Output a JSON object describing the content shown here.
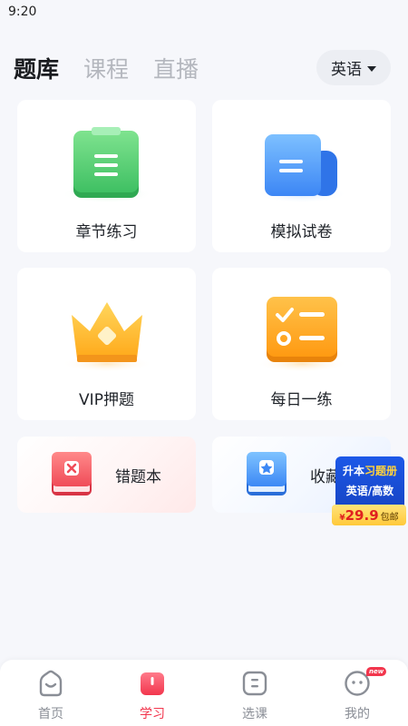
{
  "status_bar": {
    "time": "9:20"
  },
  "top_tabs": [
    {
      "label": "题库",
      "active": true
    },
    {
      "label": "课程",
      "active": false
    },
    {
      "label": "直播",
      "active": false
    }
  ],
  "subject_selector": {
    "label": "英语"
  },
  "cards": {
    "chapter_practice": {
      "label": "章节练习",
      "icon": "clipboard-icon"
    },
    "mock_exam": {
      "label": "模拟试卷",
      "icon": "document-icon"
    },
    "vip_predict": {
      "label": "VIP押题",
      "icon": "crown-icon"
    },
    "daily_practice": {
      "label": "每日一练",
      "icon": "calendar-checklist-icon"
    },
    "wrong_questions": {
      "label": "错题本",
      "icon": "wrong-book-icon"
    },
    "favorites": {
      "label": "收藏",
      "icon": "star-book-icon"
    }
  },
  "promo": {
    "line1_a": "升本",
    "line1_b": "习题册",
    "line2": "英语/高数",
    "currency": "¥",
    "price": "29.9",
    "shipping": "包邮"
  },
  "bottom_nav": [
    {
      "label": "首页",
      "icon": "home-icon",
      "active": false
    },
    {
      "label": "学习",
      "icon": "study-book-icon",
      "active": true
    },
    {
      "label": "选课",
      "icon": "course-icon",
      "active": false
    },
    {
      "label": "我的",
      "icon": "profile-icon",
      "active": false,
      "badge": "new"
    }
  ],
  "colors": {
    "accent": "#f2364d",
    "green": "#4ccf73",
    "blue": "#3d8bff",
    "gold": "#ffb22e",
    "red": "#f05563"
  }
}
